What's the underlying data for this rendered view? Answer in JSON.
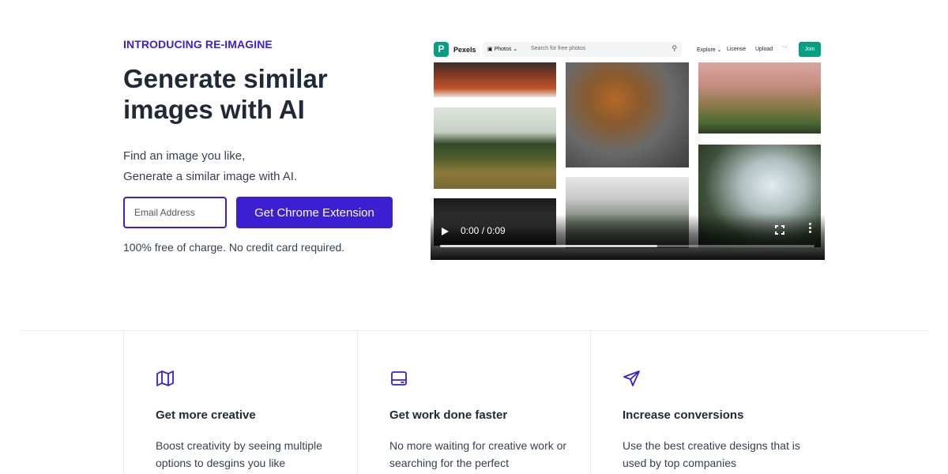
{
  "hero": {
    "eyebrow": "INTRODUCING RE-IMAGINE",
    "headline": "Generate similar images with AI",
    "sub_line1": "Find an image you like,",
    "sub_line2": "Generate a similar image with AI.",
    "email_placeholder": "Email Address",
    "cta_label": "Get Chrome Extension",
    "free_note": "100% free of charge. No credit card required."
  },
  "video": {
    "site_name": "Pexels",
    "photos_label": "Photos",
    "search_placeholder": "Search for free photos",
    "nav_explore": "Explore",
    "nav_license": "License",
    "nav_upload": "Upload",
    "nav_more": "···",
    "join_label": "Join",
    "time": "0:00 / 0:09",
    "progress": 0.58
  },
  "features": [
    {
      "title": "Get more creative",
      "desc": "Boost creativity by seeing multiple options to desgins you like",
      "icon": "map-icon"
    },
    {
      "title": "Get work done faster",
      "desc": "No more waiting for creative work or searching for the perfect",
      "icon": "window-icon"
    },
    {
      "title": "Increase conversions",
      "desc": "Use the best creative designs that is used by top companies",
      "icon": "send-icon"
    }
  ],
  "colors": {
    "accent": "#3b1fd1",
    "pexels_green": "#05a081"
  }
}
